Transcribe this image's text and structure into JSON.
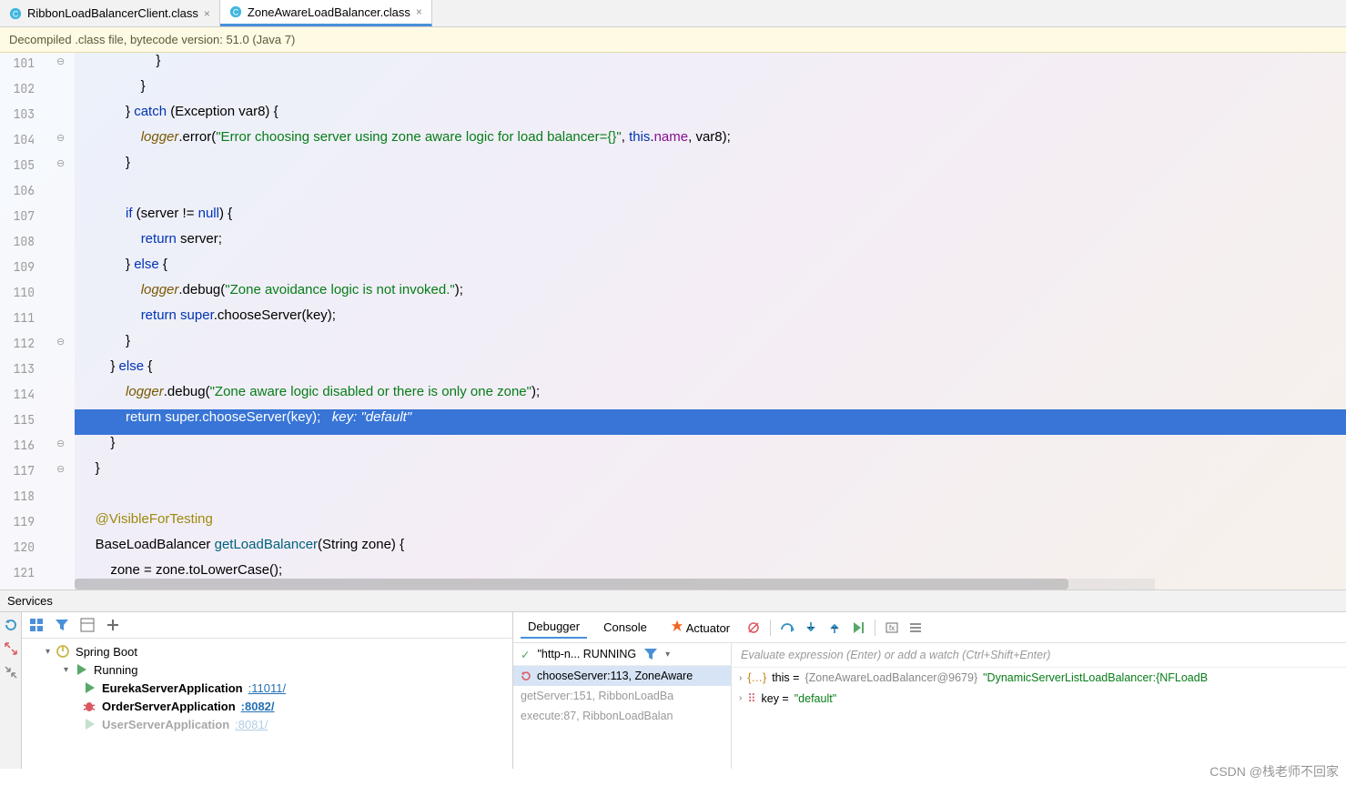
{
  "tabs": [
    {
      "label": "RibbonLoadBalancerClient.class",
      "active": false
    },
    {
      "label": "ZoneAwareLoadBalancer.class",
      "active": true
    }
  ],
  "banner": "Decompiled .class file, bytecode version: 51.0 (Java 7)",
  "lines": {
    "start": 101,
    "end": 121,
    "current": 115,
    "hint": "key: \"default\""
  },
  "code": {
    "l101": "                    }",
    "l102": "                }",
    "l103_a": "            } ",
    "l103_catch": "catch",
    "l103_b": " (Exception var8) {",
    "l104_a": "                ",
    "l104_logger": "logger",
    "l104_b": ".error(",
    "l104_str": "\"Error choosing server using zone aware logic for load balancer={}\"",
    "l104_c": ", ",
    "l104_this": "this",
    "l104_d": ".",
    "l104_name": "name",
    "l104_e": ", var8);",
    "l105": "            }",
    "l106": "",
    "l107_a": "            ",
    "l107_if": "if",
    "l107_b": " (server != ",
    "l107_null": "null",
    "l107_c": ") {",
    "l108_a": "                ",
    "l108_ret": "return",
    "l108_b": " server;",
    "l109_a": "            } ",
    "l109_else": "else",
    "l109_b": " {",
    "l110_a": "                ",
    "l110_logger": "logger",
    "l110_b": ".debug(",
    "l110_str": "\"Zone avoidance logic is not invoked.\"",
    "l110_c": ");",
    "l111_a": "                ",
    "l111_ret": "return ",
    "l111_super": "super",
    "l111_b": ".chooseServer(key);",
    "l112": "            }",
    "l113_a": "        } ",
    "l113_else": "else",
    "l113_b": " {",
    "l114_a": "            ",
    "l114_logger": "logger",
    "l114_b": ".debug(",
    "l114_str": "\"Zone aware logic disabled or there is only one zone\"",
    "l114_c": ");",
    "l115_a": "            ",
    "l115_ret": "return ",
    "l115_super": "super",
    "l115_b": ".chooseServer(key);   ",
    "l116": "        }",
    "l117": "    }",
    "l118": "",
    "l119_a": "    ",
    "l119_ann": "@VisibleForTesting",
    "l120_a": "    BaseLoadBalancer ",
    "l120_fn": "getLoadBalancer",
    "l120_b": "(String zone) {",
    "l121": "        zone = zone.toLowerCase();"
  },
  "services": {
    "title": "Services",
    "root": "Spring Boot",
    "running": "Running",
    "apps": [
      {
        "name": "EurekaServerApplication",
        "port": ":11011/",
        "icon": "play"
      },
      {
        "name": "OrderServerApplication",
        "port": ":8082/",
        "icon": "bug",
        "selected": true
      },
      {
        "name": "UserServerApplication",
        "port": ":8081/",
        "icon": "play",
        "cut": true
      }
    ]
  },
  "debugger": {
    "tabs": {
      "debugger": "Debugger",
      "console": "Console",
      "actuator": "Actuator"
    },
    "thread": "\"http-n... RUNNING",
    "frames": [
      {
        "label": "chooseServer:113, ZoneAware",
        "selected": true
      },
      {
        "label": "getServer:151, RibbonLoadBa"
      },
      {
        "label": "execute:87, RibbonLoadBalan"
      }
    ],
    "eval_hint": "Evaluate expression (Enter) or add a watch (Ctrl+Shift+Enter)",
    "vars": {
      "this_label": "this = ",
      "this_type": "{ZoneAwareLoadBalancer@9679}",
      "this_val": " \"DynamicServerListLoadBalancer:{NFLoadB",
      "key_label": "key = ",
      "key_val": "\"default\""
    }
  },
  "watermark": "CSDN @栈老师不回家"
}
